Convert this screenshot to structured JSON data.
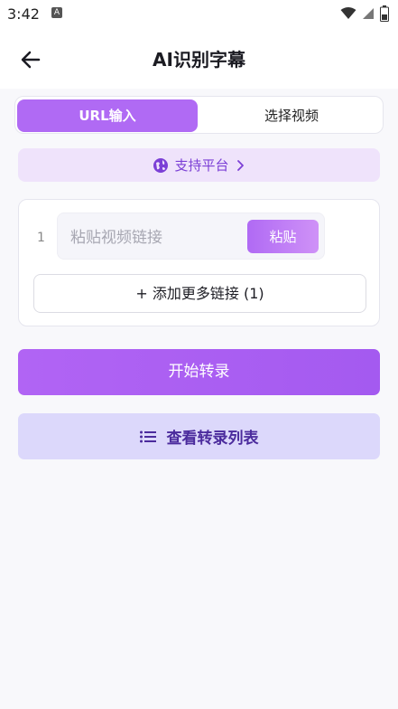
{
  "status": {
    "time": "3:42",
    "notification_letter": "A",
    "icons": [
      "wifi-icon",
      "signal-icon",
      "battery-icon"
    ]
  },
  "header": {
    "title": "AI识别字幕",
    "back_icon": "arrow-left-icon"
  },
  "tabs": [
    {
      "label": "URL输入",
      "active": true
    },
    {
      "label": "选择视频",
      "active": false
    }
  ],
  "platforms": {
    "label": "支持平台",
    "icon": "globe-icon",
    "chevron": "chevron-right-icon"
  },
  "link_input": {
    "index": "1",
    "placeholder": "粘贴视频链接",
    "value": "",
    "paste_label": "粘贴"
  },
  "add_more": {
    "label": "+ 添加更多链接 (1)"
  },
  "start_button": {
    "label": "开始转录"
  },
  "list_button": {
    "label": "查看转录列表",
    "icon": "list-icon"
  },
  "colors": {
    "accent": "#b06af4",
    "accent_light": "#efe3fb",
    "list_bg": "#dcd8fb",
    "list_text": "#4b2b9d",
    "background": "#f8f8fb"
  }
}
